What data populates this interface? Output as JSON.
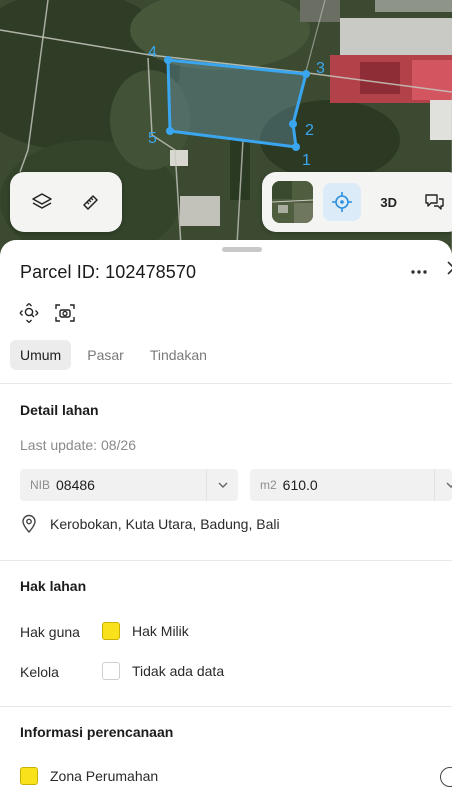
{
  "map": {
    "vertex_labels": [
      "1",
      "2",
      "3",
      "4",
      "5"
    ],
    "parcel_color": "#3aa6f0",
    "buttons": {
      "layers_icon": "layers-icon",
      "measure_icon": "ruler-icon",
      "basemap_icon": "satellite-thumbnail",
      "locate_icon": "crosshair-icon",
      "view_3d_label": "3D",
      "feedback_icon": "chat-icon"
    }
  },
  "parcel": {
    "title": "Parcel ID: 102478570",
    "more_icon": "more-icon",
    "close_icon": "close-icon",
    "tools": [
      "search-zoom-icon",
      "camera-icon"
    ]
  },
  "tabs": [
    {
      "label": "Umum",
      "active": true
    },
    {
      "label": "Pasar",
      "active": false
    },
    {
      "label": "Tindakan",
      "active": false
    }
  ],
  "detail": {
    "title": "Detail lahan",
    "last_update": "Last update: 08/26",
    "nib_prefix": "NIB",
    "nib_value": "08486",
    "area_prefix": "m2",
    "area_value": "610.0",
    "address": "Kerobokan, Kuta Utara, Badung, Bali"
  },
  "hak": {
    "title": "Hak lahan",
    "rows": [
      {
        "label": "Hak guna",
        "value": "Hak Milik",
        "swatch": "#f9e21c"
      },
      {
        "label": "Kelola",
        "value": "Tidak ada data",
        "swatch": ""
      }
    ]
  },
  "planning": {
    "title": "Informasi perencanaan",
    "zone_label": "Zona Perumahan",
    "zone_color": "#f9e21c"
  }
}
